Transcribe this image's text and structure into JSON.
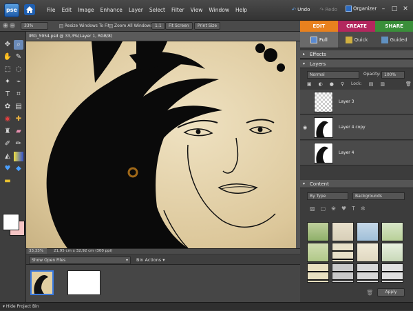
{
  "app": {
    "logo_text": "pse",
    "title_menu": [
      "File",
      "Edit",
      "Image",
      "Enhance",
      "Layer",
      "Select",
      "Filter",
      "View",
      "Window",
      "Help"
    ]
  },
  "toolbar_right": {
    "undo": "Undo",
    "redo": "Redo",
    "organizer": "Organizer"
  },
  "window_controls": {
    "minimize": "–",
    "maximize": "□",
    "close": "✕"
  },
  "options_bar": {
    "zoom": "33%",
    "resize_windows": "Resize Windows To Fit",
    "zoom_all": "Zoom All Windows",
    "one_to_one": "1:1",
    "fit_screen": "Fit Screen",
    "print_size": "Print Size"
  },
  "mode_tabs": [
    {
      "label": "EDIT",
      "color": "#e8811e"
    },
    {
      "label": "CREATE",
      "color": "#b3275e"
    },
    {
      "label": "SHARE",
      "color": "#3a8f3a"
    }
  ],
  "document": {
    "tab_title": "IMG_5954.psd @ 33,3%(Layer 1, RGB/8)",
    "status_zoom": "33,33%",
    "status_size": "21,95 cm x 32,92 cm (300 ppi)"
  },
  "bin": {
    "dropdown": "Show Open Files",
    "actions": "Bin Actions",
    "hide": "Hide Project Bin"
  },
  "panels": {
    "view_tabs": [
      "Full",
      "Quick",
      "Guided"
    ],
    "effects": "Effects",
    "layers": "Layers",
    "blend_mode": "Normal",
    "opacity_label": "Opacity:",
    "opacity_value": "100%",
    "lock_label": "Lock:",
    "layer_list": [
      "Layer 3",
      "Layer 4 copy",
      "Layer 4"
    ],
    "content": "Content",
    "content_filter": "By Type",
    "content_category": "Backgrounds",
    "apply": "Apply"
  }
}
